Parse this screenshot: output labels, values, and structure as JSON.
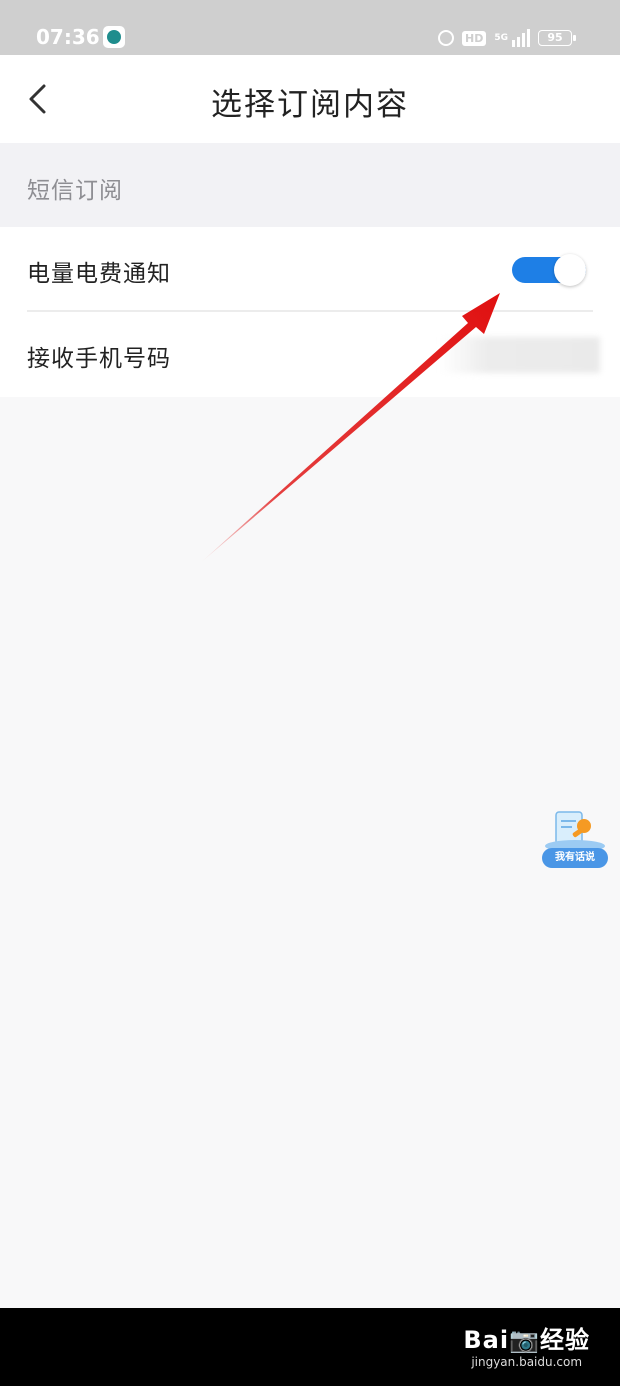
{
  "status_bar": {
    "time": "07:36",
    "network": "5G",
    "battery": "95",
    "icons": [
      "app-icon",
      "alarm-icon",
      "hd-icon",
      "signal-icon",
      "battery-icon"
    ]
  },
  "header": {
    "title": "选择订阅内容",
    "back_icon": "chevron-left-icon"
  },
  "section": {
    "title": "短信订阅"
  },
  "rows": [
    {
      "label": "电量电费通知",
      "control": "toggle",
      "toggle_on": true,
      "accent_color": "#1e7fe6"
    },
    {
      "label": "接收手机号码",
      "value_state": "blurred"
    }
  ],
  "floating_button": {
    "label": "我有话说",
    "icon": "microphone-icon"
  },
  "annotation": {
    "type": "arrow",
    "color": "#e01010"
  },
  "watermark": {
    "logo": "Bai📷经验",
    "url": "jingyan.baidu.com"
  }
}
